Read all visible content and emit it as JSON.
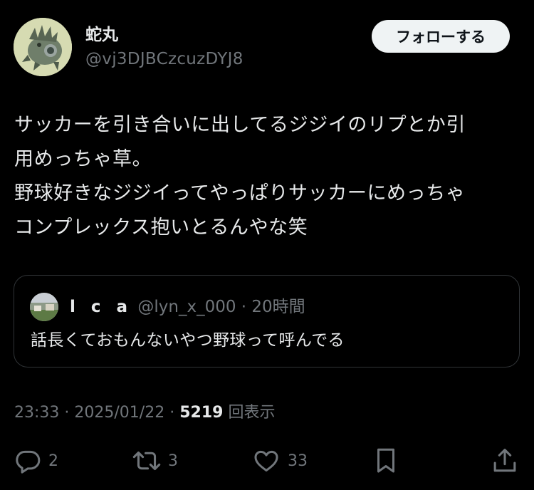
{
  "author": {
    "name": "蛇丸",
    "handle": "@vj3DJBCzcuzDYJ8",
    "avatar_icon": "monster-avatar"
  },
  "follow_label": "フォローする",
  "tweet": {
    "lines": [
      "サッカーを引き合いに出してるジジイのリプとか引",
      "用めっちゃ草。",
      "野球好きなジジイってやっぱりサッカーにめっちゃ",
      "コンプレックス抱いとるんやな笑"
    ]
  },
  "quote": {
    "name": "l c a",
    "handle": "@lyn_x_000",
    "separator": "·",
    "time": "20時間",
    "text": "話長くておもんないやつ野球って呼んでる",
    "avatar_icon": "landscape-avatar"
  },
  "meta": {
    "time": "23:33",
    "separator": "·",
    "date": "2025/01/22",
    "views_count": "5219",
    "views_label": "回表示"
  },
  "actions": {
    "reply_count": "2",
    "retweet_count": "3",
    "like_count": "33"
  },
  "colors": {
    "background": "#000000",
    "text": "#e7e9ea",
    "secondary": "#71767b",
    "border": "#2f3336",
    "follow_bg": "#eff3f4"
  }
}
